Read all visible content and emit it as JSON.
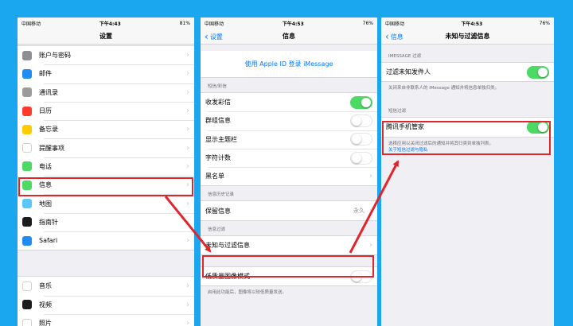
{
  "screen1": {
    "status": {
      "carrier": "中国移动",
      "time": "下午4:43",
      "battery": "81%"
    },
    "title": "设置",
    "items": [
      {
        "label": "账户与密码",
        "icon": "key-icon",
        "color": "#8e8e93"
      },
      {
        "label": "邮件",
        "icon": "mail-icon",
        "color": "#1e8cf0"
      },
      {
        "label": "通讯录",
        "icon": "contacts-icon",
        "color": "#9b9b9b"
      },
      {
        "label": "日历",
        "icon": "calendar-icon",
        "color": "#ff3b30"
      },
      {
        "label": "备忘录",
        "icon": "notes-icon",
        "color": "#ffcc00"
      },
      {
        "label": "提醒事项",
        "icon": "reminders-icon",
        "color": "#ffffff"
      },
      {
        "label": "电话",
        "icon": "phone-icon",
        "color": "#4cd964"
      },
      {
        "label": "信息",
        "icon": "messages-icon",
        "color": "#4cd964"
      },
      {
        "label": "地图",
        "icon": "maps-icon",
        "color": "#5ac8fa"
      },
      {
        "label": "指南针",
        "icon": "compass-icon",
        "color": "#1c1c1e"
      },
      {
        "label": "Safari",
        "icon": "safari-icon",
        "color": "#1e8cf0"
      }
    ],
    "items2": [
      {
        "label": "音乐",
        "icon": "music-icon",
        "color": "#ffffff"
      },
      {
        "label": "视频",
        "icon": "videos-icon",
        "color": "#1c1c1e"
      },
      {
        "label": "照片",
        "icon": "photos-icon",
        "color": "#ffffff"
      }
    ]
  },
  "screen2": {
    "status": {
      "carrier": "中国移动",
      "time": "下午4:53",
      "battery": "76%"
    },
    "back": "设置",
    "title": "信息",
    "imessage_link": "使用 Apple ID 登录 iMessage",
    "sms_header": "短信/彩信",
    "sms_items": [
      {
        "label": "收发彩信",
        "state": "on"
      },
      {
        "label": "群组信息",
        "state": "off"
      },
      {
        "label": "显示主题栏",
        "state": "off"
      },
      {
        "label": "字符计数",
        "state": "off"
      },
      {
        "label": "黑名单",
        "state": "chevron"
      }
    ],
    "history_header": "信息历史记录",
    "keep_label": "保留信息",
    "keep_value": "永久",
    "filter_header": "信息过滤",
    "filter_label": "未知与过滤信息",
    "lowquality_label": "低质量图像模式",
    "lowquality_footer": "启用此功能后，图像将以较低质量发送。"
  },
  "screen3": {
    "status": {
      "carrier": "中国移动",
      "time": "下午4:53",
      "battery": "76%"
    },
    "back": "信息",
    "title": "未知与过滤信息",
    "imessage_header": "IMESSAGE 过滤",
    "filter_unknown_label": "过滤未知发件人",
    "filter_unknown_footer": "关闭来自非联系人的 iMessage 通知并将信息单独归类。",
    "sms_filter_header": "短信过滤",
    "tencent_label": "腾讯手机管家",
    "tencent_footer": "选择应用以关闭过滤后的通知并将其归类到单独列表。",
    "tencent_link": "关于短信过滤与隐私"
  },
  "colors": {
    "background": "#1aa7f0",
    "highlight": "#e0262d",
    "toggle_on": "#4cd964",
    "link": "#007aff"
  }
}
